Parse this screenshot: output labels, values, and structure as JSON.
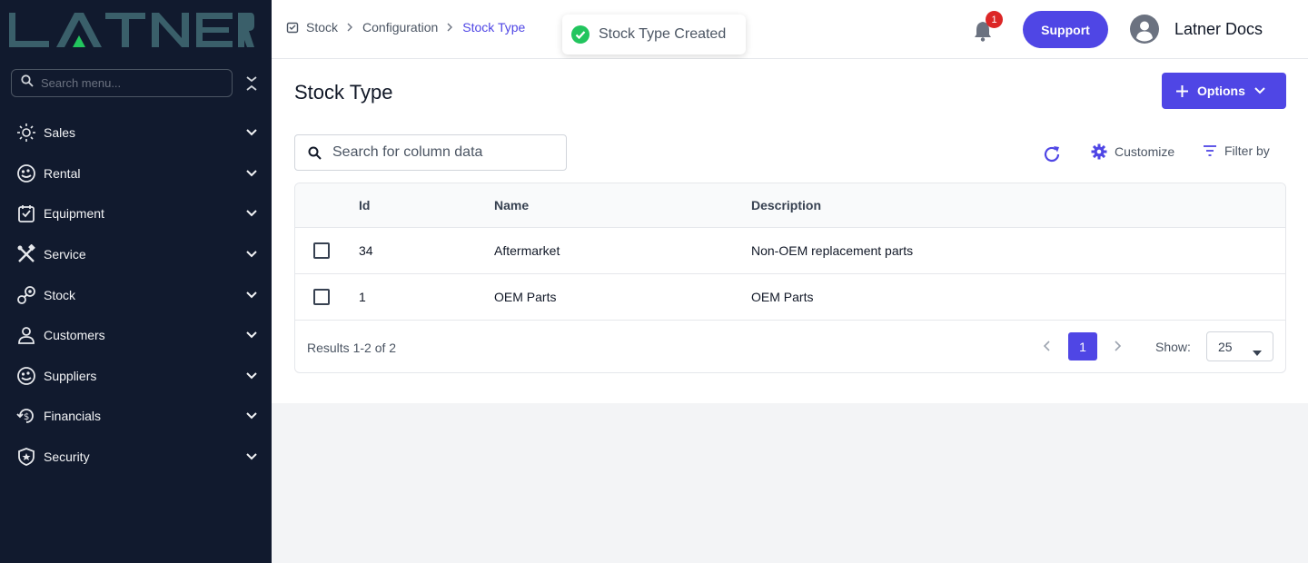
{
  "sidebar": {
    "logo_text": "LATNER",
    "search_placeholder": "Search menu...",
    "items": [
      {
        "label": "Sales",
        "icon": "sales-icon"
      },
      {
        "label": "Rental",
        "icon": "rental-icon"
      },
      {
        "label": "Equipment",
        "icon": "equipment-icon"
      },
      {
        "label": "Service",
        "icon": "service-icon"
      },
      {
        "label": "Stock",
        "icon": "stock-icon"
      },
      {
        "label": "Customers",
        "icon": "customers-icon"
      },
      {
        "label": "Suppliers",
        "icon": "suppliers-icon"
      },
      {
        "label": "Financials",
        "icon": "financials-icon"
      },
      {
        "label": "Security",
        "icon": "security-icon"
      }
    ]
  },
  "header": {
    "breadcrumb": [
      "Stock",
      "Configuration",
      "Stock Type"
    ],
    "toast": "Stock Type Created",
    "notification_count": "1",
    "support_label": "Support",
    "user_name": "Latner Docs"
  },
  "main": {
    "title": "Stock Type",
    "options_label": "Options",
    "search_placeholder": "Search for column data",
    "customize_label": "Customize",
    "filter_label": "Filter by",
    "table": {
      "columns": [
        "Id",
        "Name",
        "Description"
      ],
      "rows": [
        {
          "id": "34",
          "name": "Aftermarket",
          "description": "Non-OEM replacement parts"
        },
        {
          "id": "1",
          "name": "OEM Parts",
          "description": "OEM Parts"
        }
      ]
    },
    "results_text": "Results 1-2 of 2",
    "current_page": "1",
    "show_label": "Show:",
    "page_size": "25"
  },
  "colors": {
    "sidebar_bg": "#111a2e",
    "accent": "#4f46e5",
    "logo": "#3a5f6a",
    "logo_accent": "#22c55e",
    "success": "#22c55e",
    "badge": "#dc2626"
  }
}
